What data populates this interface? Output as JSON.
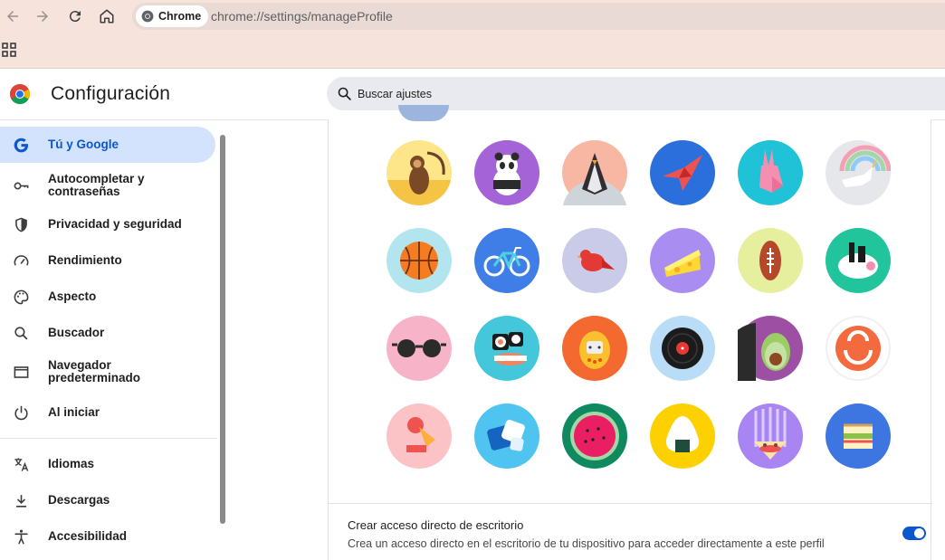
{
  "browser": {
    "chip_label": "Chrome",
    "url": "chrome://settings/manageProfile",
    "toolbar_color": "#f5e3dc",
    "icons": [
      "back-arrow-icon",
      "forward-arrow-icon",
      "reload-icon",
      "home-icon",
      "apps-grid-icon"
    ]
  },
  "header": {
    "title": "Configuración",
    "search_placeholder": "Buscar ajustes"
  },
  "sidebar": {
    "items": [
      {
        "label": "Tú y Google",
        "icon": "google-g-icon",
        "active": true
      },
      {
        "label": "Autocompletar y contraseñas",
        "icon": "key-icon",
        "active": false
      },
      {
        "label": "Privacidad y seguridad",
        "icon": "shield-icon",
        "active": false
      },
      {
        "label": "Rendimiento",
        "icon": "speedometer-icon",
        "active": false
      },
      {
        "label": "Aspecto",
        "icon": "palette-icon",
        "active": false
      },
      {
        "label": "Buscador",
        "icon": "search-icon",
        "active": false
      },
      {
        "label": "Navegador predeterminado",
        "icon": "browser-window-icon",
        "active": false
      },
      {
        "label": "Al iniciar",
        "icon": "power-icon",
        "active": false
      },
      {
        "label": "Idiomas",
        "icon": "translate-icon",
        "active": false
      },
      {
        "label": "Descargas",
        "icon": "download-icon",
        "active": false
      },
      {
        "label": "Accesibilidad",
        "icon": "accessibility-icon",
        "active": false
      }
    ]
  },
  "avatars": [
    "monkey",
    "panda",
    "penguin",
    "origami-bird",
    "rabbit",
    "unicorn",
    "basketball",
    "bicycle",
    "red-bird",
    "cheese",
    "football",
    "sushi-bowl",
    "sunglasses",
    "sushi-rolls",
    "tamagotchi",
    "vinyl-record",
    "avocado",
    "smile",
    "ice-cream",
    "cube",
    "watermelon",
    "onigiri",
    "pizza",
    "sandwich"
  ],
  "shortcut": {
    "title": "Crear acceso directo de escritorio",
    "description": "Crea un acceso directo en el escritorio de tu dispositivo para acceder directamente a este perfil",
    "enabled": true
  },
  "colors": {
    "accent": "#0b57d0",
    "active_nav_bg": "#d3e3fd"
  }
}
